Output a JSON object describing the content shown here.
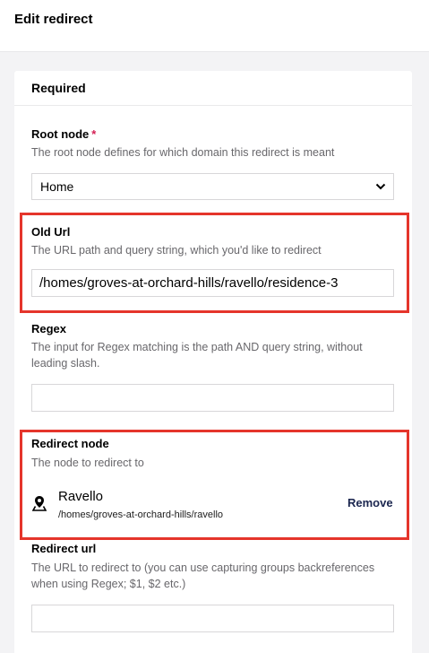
{
  "header": {
    "title": "Edit redirect"
  },
  "card": {
    "title": "Required"
  },
  "root_node": {
    "label": "Root node",
    "required_marker": "*",
    "description": "The root node defines for which domain this redirect is meant",
    "selected": "Home"
  },
  "old_url": {
    "label": "Old Url",
    "description": "The URL path and query string, which you'd like to redirect",
    "value": "/homes/groves-at-orchard-hills/ravello/residence-3"
  },
  "regex": {
    "label": "Regex",
    "description_line1": "The input for Regex matching is the path AND query string, without",
    "description_line2": "leading slash.",
    "value": ""
  },
  "redirect_node": {
    "label": "Redirect node",
    "description": "The node to redirect to",
    "node_name": "Ravello",
    "node_path": "/homes/groves-at-orchard-hills/ravello",
    "node_icon": "map-pin-icon",
    "remove_label": "Remove"
  },
  "redirect_url": {
    "label": "Redirect url",
    "description_line1": "The URL to redirect to (you can use capturing groups backreferences",
    "description_line2": "when using Regex; $1, $2 etc.)",
    "value": ""
  },
  "colors": {
    "highlight": "#e5352b",
    "required": "#d42054",
    "link": "#1b264f"
  }
}
